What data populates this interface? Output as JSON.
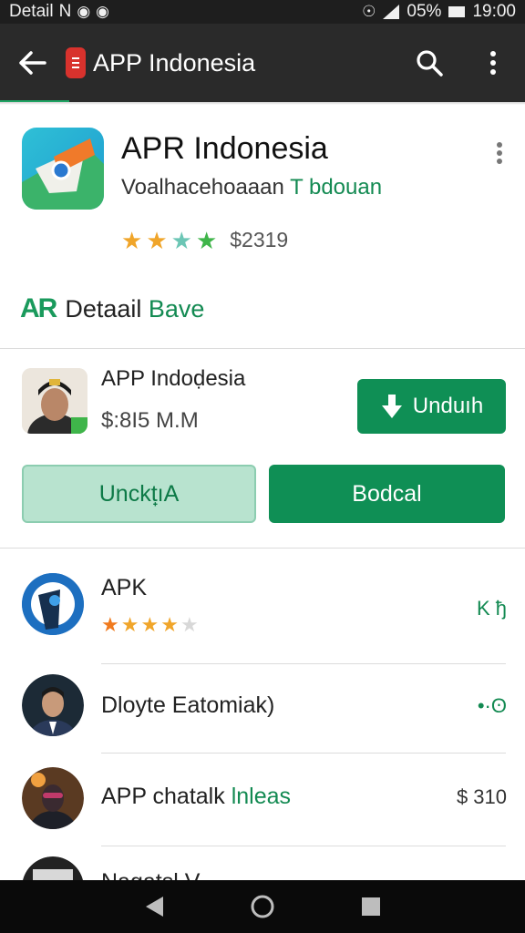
{
  "status_bar": {
    "left_text": "Detail",
    "carrier": "N",
    "battery": "05%",
    "time": "19:00"
  },
  "app_bar": {
    "title": "APP Indonesia"
  },
  "app_header": {
    "title": "APR Indonesia",
    "developer_prefix": "Voalhacehoaaan ",
    "developer_accent": "T bdouan",
    "rating_stars": 4,
    "price": "$2319",
    "star_colors": [
      "#f0a52a",
      "#f0a52a",
      "#6cc6b5",
      "#3fb54a"
    ]
  },
  "detail_section": {
    "brand": "AR",
    "label": "Detaail ",
    "label_accent": "Bave"
  },
  "featured": {
    "title": "APP Indoḍesia",
    "size": "$:8I5 M.M",
    "download_label": "Unduıh",
    "outline_button": "Unckt̟ıA",
    "solid_button": "Bodcal"
  },
  "list": [
    {
      "title": "APK",
      "meta": "K ђ",
      "rating": 4,
      "star_colors": [
        "#f07a1e",
        "#f0a52a",
        "#f0a52a",
        "#f0a52a",
        "#d8d8d8"
      ]
    },
    {
      "title": "Dloyte Eatomiak)",
      "meta": "•·ʘ"
    },
    {
      "title": "APP chatalk ",
      "title_accent": "lnleas",
      "meta": "$ 310"
    },
    {
      "title": "Nagatsl V"
    }
  ],
  "colors": {
    "accent_green": "#0f8f55",
    "app_bar": "#2a2a2a",
    "status_bar": "#1e1e1e"
  }
}
